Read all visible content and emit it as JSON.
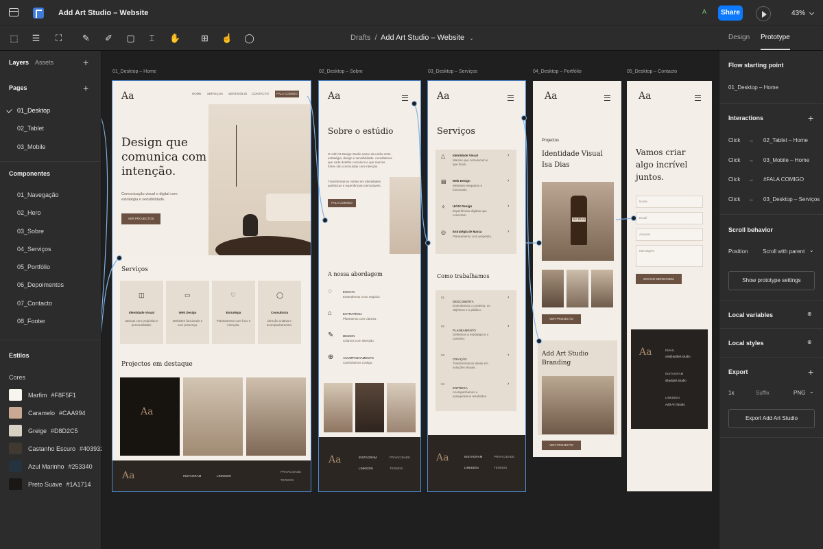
{
  "topbar": {
    "file_title": "Add Art Studio – Website",
    "avatar": "A",
    "share": "Share",
    "zoom": "43%"
  },
  "toolbar": {
    "breadcrumb_root": "Drafts",
    "breadcrumb_sep": "/",
    "breadcrumb_file": "Add Art Studio – Website",
    "tabs": [
      "Design",
      "Prototype"
    ],
    "active_tab": "Prototype"
  },
  "left": {
    "tabs": [
      "Layers",
      "Assets"
    ],
    "pages_title": "Pages",
    "pages": [
      "01_Desktop",
      "02_Tablet",
      "03_Mobile"
    ],
    "components_title": "Componentes",
    "components": [
      "01_Navegação",
      "02_Hero",
      "03_Sobre",
      "04_Serviços",
      "05_Portfólio",
      "06_Depoimentos",
      "07_Contacto",
      "08_Footer"
    ],
    "styles_title": "Estilos",
    "colors_title": "Cores",
    "colors": [
      {
        "name": "Marfim",
        "hex": "#F8F5F1"
      },
      {
        "name": "Caramelo",
        "hex": "#CAA994"
      },
      {
        "name": "Greige",
        "hex": "#D8D2C5"
      },
      {
        "name": "Castanho Escuro",
        "hex": "#403932"
      },
      {
        "name": "Azul Marinho",
        "hex": "#253340"
      },
      {
        "name": "Preto Suave",
        "hex": "#1A1714"
      }
    ]
  },
  "right": {
    "flow_title": "Flow starting point",
    "flow_value": "01_Desktop – Home",
    "interactions_title": "Interactions",
    "interactions": [
      {
        "trigger": "Click",
        "target": "02_Tablet – Home"
      },
      {
        "trigger": "Click",
        "target": "03_Mobile – Home"
      },
      {
        "trigger": "Click",
        "target": "#FALA COMIGO"
      },
      {
        "trigger": "Click",
        "target": "03_Desktop – Serviços"
      }
    ],
    "arrow": "→",
    "scroll_title": "Scroll behavior",
    "position_label": "Position",
    "position_value": "Scroll with parent",
    "prototype_settings": "Show prototype settings",
    "local_variables": "Local variables",
    "local_styles": "Local styles",
    "export_title": "Export",
    "export_scale": "1x",
    "export_suffix": "Suffix",
    "export_format": "PNG",
    "export_button": "Export Add Art Studio"
  },
  "frames": {
    "labels": [
      "01_Desktop – Home",
      "02_Desktop – Sobre",
      "03_Desktop – Serviços",
      "04_Desktop – Portfólio",
      "05_Desktop – Contacto"
    ],
    "logo": "Aa",
    "home": {
      "nav": [
        "HOME",
        "SERVIÇOS",
        "SENTIDÓLIO",
        "CONTACTO"
      ],
      "nav_cta": "FALA COMIGO",
      "hero_title": "Design que comunica com intenção.",
      "hero_sub": "Comunicação visual e digital com estratégia e sensibilidade.",
      "hero_btn": "VER PROJECTOS",
      "services_title": "Serviços",
      "services": [
        {
          "name": "Identidade Visual",
          "desc": "Marcas com propósito e personalidade."
        },
        {
          "name": "Web Design",
          "desc": "Websites funcionais e com presença."
        },
        {
          "name": "Estratégia",
          "desc": "Planeamento com foco e intenção."
        },
        {
          "name": "Consultoria",
          "desc": "Direção criativa e acompanhamento."
        }
      ],
      "projects_title": "Projectos em destaque",
      "footer": [
        "INSTAGRAM",
        "LINKEDIN"
      ],
      "footer_legal": [
        "PRIVACIDADE",
        "TERMOS"
      ]
    },
    "sobre": {
      "title": "Sobre o estúdio",
      "p1": "O Add Art Design Studio nasce da união entre estratégia, design e sensibilidade. Acreditamos que cada detalhe comunica e que marcas fortes são construídas com intenção.",
      "p2": "Transformamos visões em identidades autênticas e experiências memoráveis.",
      "btn": "FALA COMIGO",
      "approach_title": "A nossa abordagem",
      "steps": [
        {
          "name": "ESCUTA",
          "desc": "Entendemos o teu negócio."
        },
        {
          "name": "ESTRATÉGIA",
          "desc": "Planeamos com clareza."
        },
        {
          "name": "DESIGN",
          "desc": "Criamos com intenção."
        },
        {
          "name": "ACOMPANHAMENTO",
          "desc": "Caminhamos contigo."
        }
      ],
      "footer": [
        "INSTAGRAM",
        "LINKEDIN"
      ],
      "footer_legal": [
        "PRIVACIDADE",
        "TERMOS"
      ]
    },
    "servicos": {
      "title": "Serviços",
      "items": [
        {
          "name": "Identidade Visual",
          "desc": "Marcas que comunicam e que ficam."
        },
        {
          "name": "Web Design",
          "desc": "Websites elegantes e funcionais."
        },
        {
          "name": "UI/UX Design",
          "desc": "Experiências digitais que conectam."
        },
        {
          "name": "Estratégia de Marca",
          "desc": "Planeamento com propósito."
        }
      ],
      "how_title": "Como trabalhamos",
      "steps": [
        {
          "num": "01",
          "name": "DESCOBERTA",
          "desc": "Entendemos o contexto, os objetivos e o público."
        },
        {
          "num": "02",
          "name": "PLANEAMENTO",
          "desc": "Definimos a estratégia e o caminho."
        },
        {
          "num": "03",
          "name": "CRIAÇÃO",
          "desc": "Transformamos ideias em soluções visuais."
        },
        {
          "num": "04",
          "name": "ENTREGA",
          "desc": "Acompanhamos e asseguramos resultados."
        }
      ],
      "footer": [
        "INSTAGRAM",
        "LINKEDIN"
      ],
      "footer_legal": [
        "PRIVACIDADE",
        "TERMOS"
      ]
    },
    "portfolio": {
      "kicker": "Projectos",
      "title1": "Identidade Visual Isa Dias",
      "bottle_label": "ISA DIAS",
      "btn1": "VER PROJECTO",
      "title2": "Add Art Studio Branding",
      "btn2": "VER PROJECTO"
    },
    "contacto": {
      "title": "Vamos criar algo incrível juntos.",
      "fields": [
        "Nome",
        "Email",
        "Assunto",
        "Mensagem"
      ],
      "btn": "ENVIAR MENSAGEM",
      "email_label": "EMAIL",
      "email": "ola@addart.studio",
      "ig_label": "INSTAGRAM",
      "ig": "@addart.studio",
      "li_label": "LINKEDIN",
      "li": "Add Art Studio"
    }
  }
}
